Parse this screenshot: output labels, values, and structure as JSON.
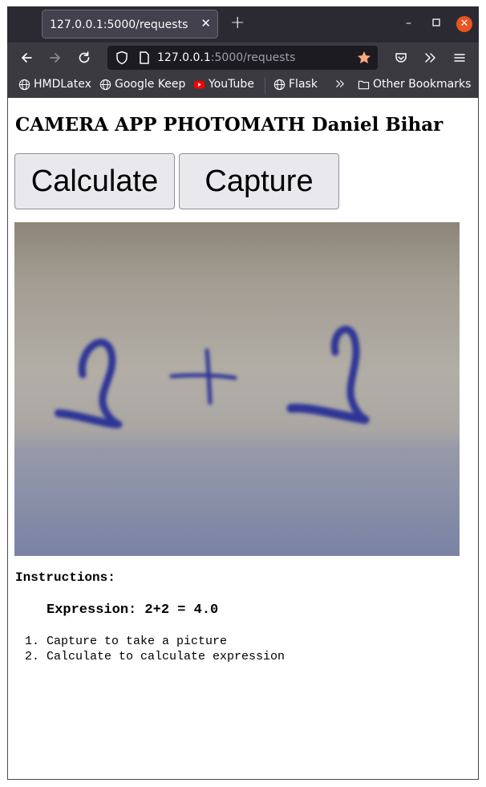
{
  "browser": {
    "tab_title": "127.0.0.1:5000/requests",
    "url_host": "127.0.0.1",
    "url_path": ":5000/requests",
    "bookmarks": [
      "HMDLatex",
      "Google Keep",
      "YouTube",
      "Flask"
    ],
    "other_bookmarks": "Other Bookmarks"
  },
  "page": {
    "title": "CAMERA APP PHOTOMATH Daniel Bihar",
    "buttons": {
      "calculate": "Calculate",
      "capture": "Capture"
    },
    "instructions_heading": "Instructions:",
    "expression": "Expression: 2+2 = 4.0",
    "steps": [
      "Capture to take a picture",
      "Calculate to calculate expression"
    ]
  },
  "colors": {
    "youtube_red": "#ff0000",
    "close_orange": "#e95420",
    "bookmark_star": "#f9a87e"
  }
}
